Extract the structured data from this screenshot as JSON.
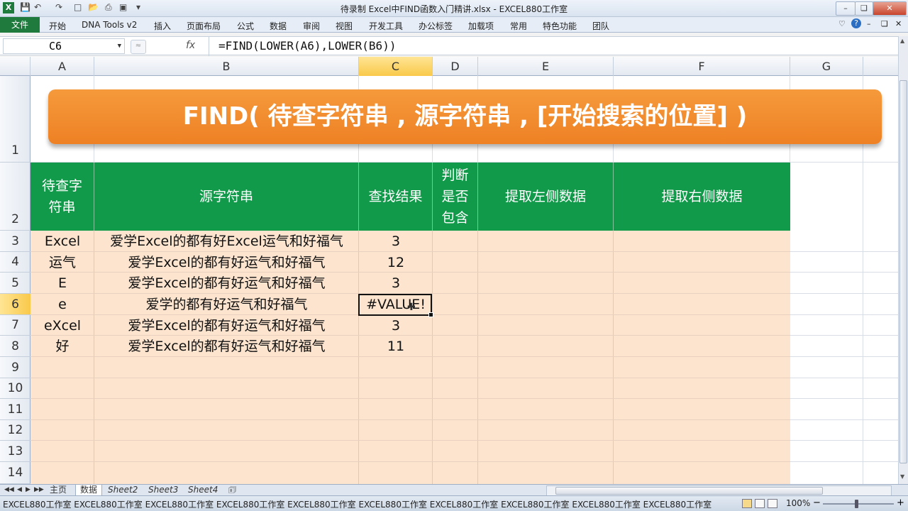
{
  "window": {
    "title": "待录制 Excel中FIND函数入门精讲.xlsx - EXCEL880工作室",
    "app_icon": "excel-icon",
    "quick_access": [
      "save-icon",
      "undo-icon",
      "redo-icon",
      "new-icon",
      "open-icon",
      "print-icon",
      "preview-icon",
      "spelling-icon",
      "customize-icon"
    ]
  },
  "ribbon": {
    "file_tab": "文件",
    "tabs": [
      "开始",
      "DNA Tools v2",
      "插入",
      "页面布局",
      "公式",
      "数据",
      "审阅",
      "视图",
      "开发工具",
      "办公标签",
      "加载项",
      "常用",
      "特色功能",
      "团队"
    ]
  },
  "formula_bar": {
    "name_box": "C6",
    "fx_label": "fx",
    "formula": "=FIND(LOWER(A6),LOWER(B6))"
  },
  "grid": {
    "columns": [
      "A",
      "B",
      "C",
      "D",
      "E",
      "F",
      "G"
    ],
    "selected_column": "C",
    "rows": [
      "1",
      "2",
      "3",
      "4",
      "5",
      "6",
      "7",
      "8",
      "9",
      "10",
      "11",
      "12",
      "13",
      "14"
    ],
    "selected_row": "6",
    "banner": "FIND( 待查字符串 , 源字符串 , [开始搜索的位置]   )"
  },
  "table": {
    "headers": {
      "a": "待查字\n符串",
      "b": "源字符串",
      "c": "查找结果",
      "d": "判断\n是否\n包含",
      "e": "提取左侧数据",
      "f": "提取右侧数据"
    },
    "rows": [
      {
        "a": "Excel",
        "b": "爱学Excel的都有好Excel运气和好福气",
        "c": "3"
      },
      {
        "a": "运气",
        "b": "爱学Excel的都有好运气和好福气",
        "c": "12"
      },
      {
        "a": "E",
        "b": "爱学Excel的都有好运气和好福气",
        "c": "3"
      },
      {
        "a": "e",
        "b": "爱学的都有好运气和好福气",
        "c": "#VALUE!"
      },
      {
        "a": "eXcel",
        "b": "爱学Excel的都有好运气和好福气",
        "c": "3"
      },
      {
        "a": "好",
        "b": "爱学Excel的都有好运气和好福气",
        "c": "11"
      }
    ]
  },
  "sheets": {
    "tabs": [
      "主页",
      "数据",
      "Sheet2",
      "Sheet3",
      "Sheet4"
    ],
    "active": "数据"
  },
  "status_bar": {
    "text": "EXCEL880工作室  EXCEL880工作室  EXCEL880工作室  EXCEL880工作室  EXCEL880工作室  EXCEL880工作室  EXCEL880工作室  EXCEL880工作室  EXCEL880工作室  EXCEL880工作室",
    "zoom": "100%"
  },
  "colors": {
    "banner": "#f08a2c",
    "header_green": "#109a4a",
    "body_fill": "#fce4cf",
    "selection": "#f9c94a"
  }
}
